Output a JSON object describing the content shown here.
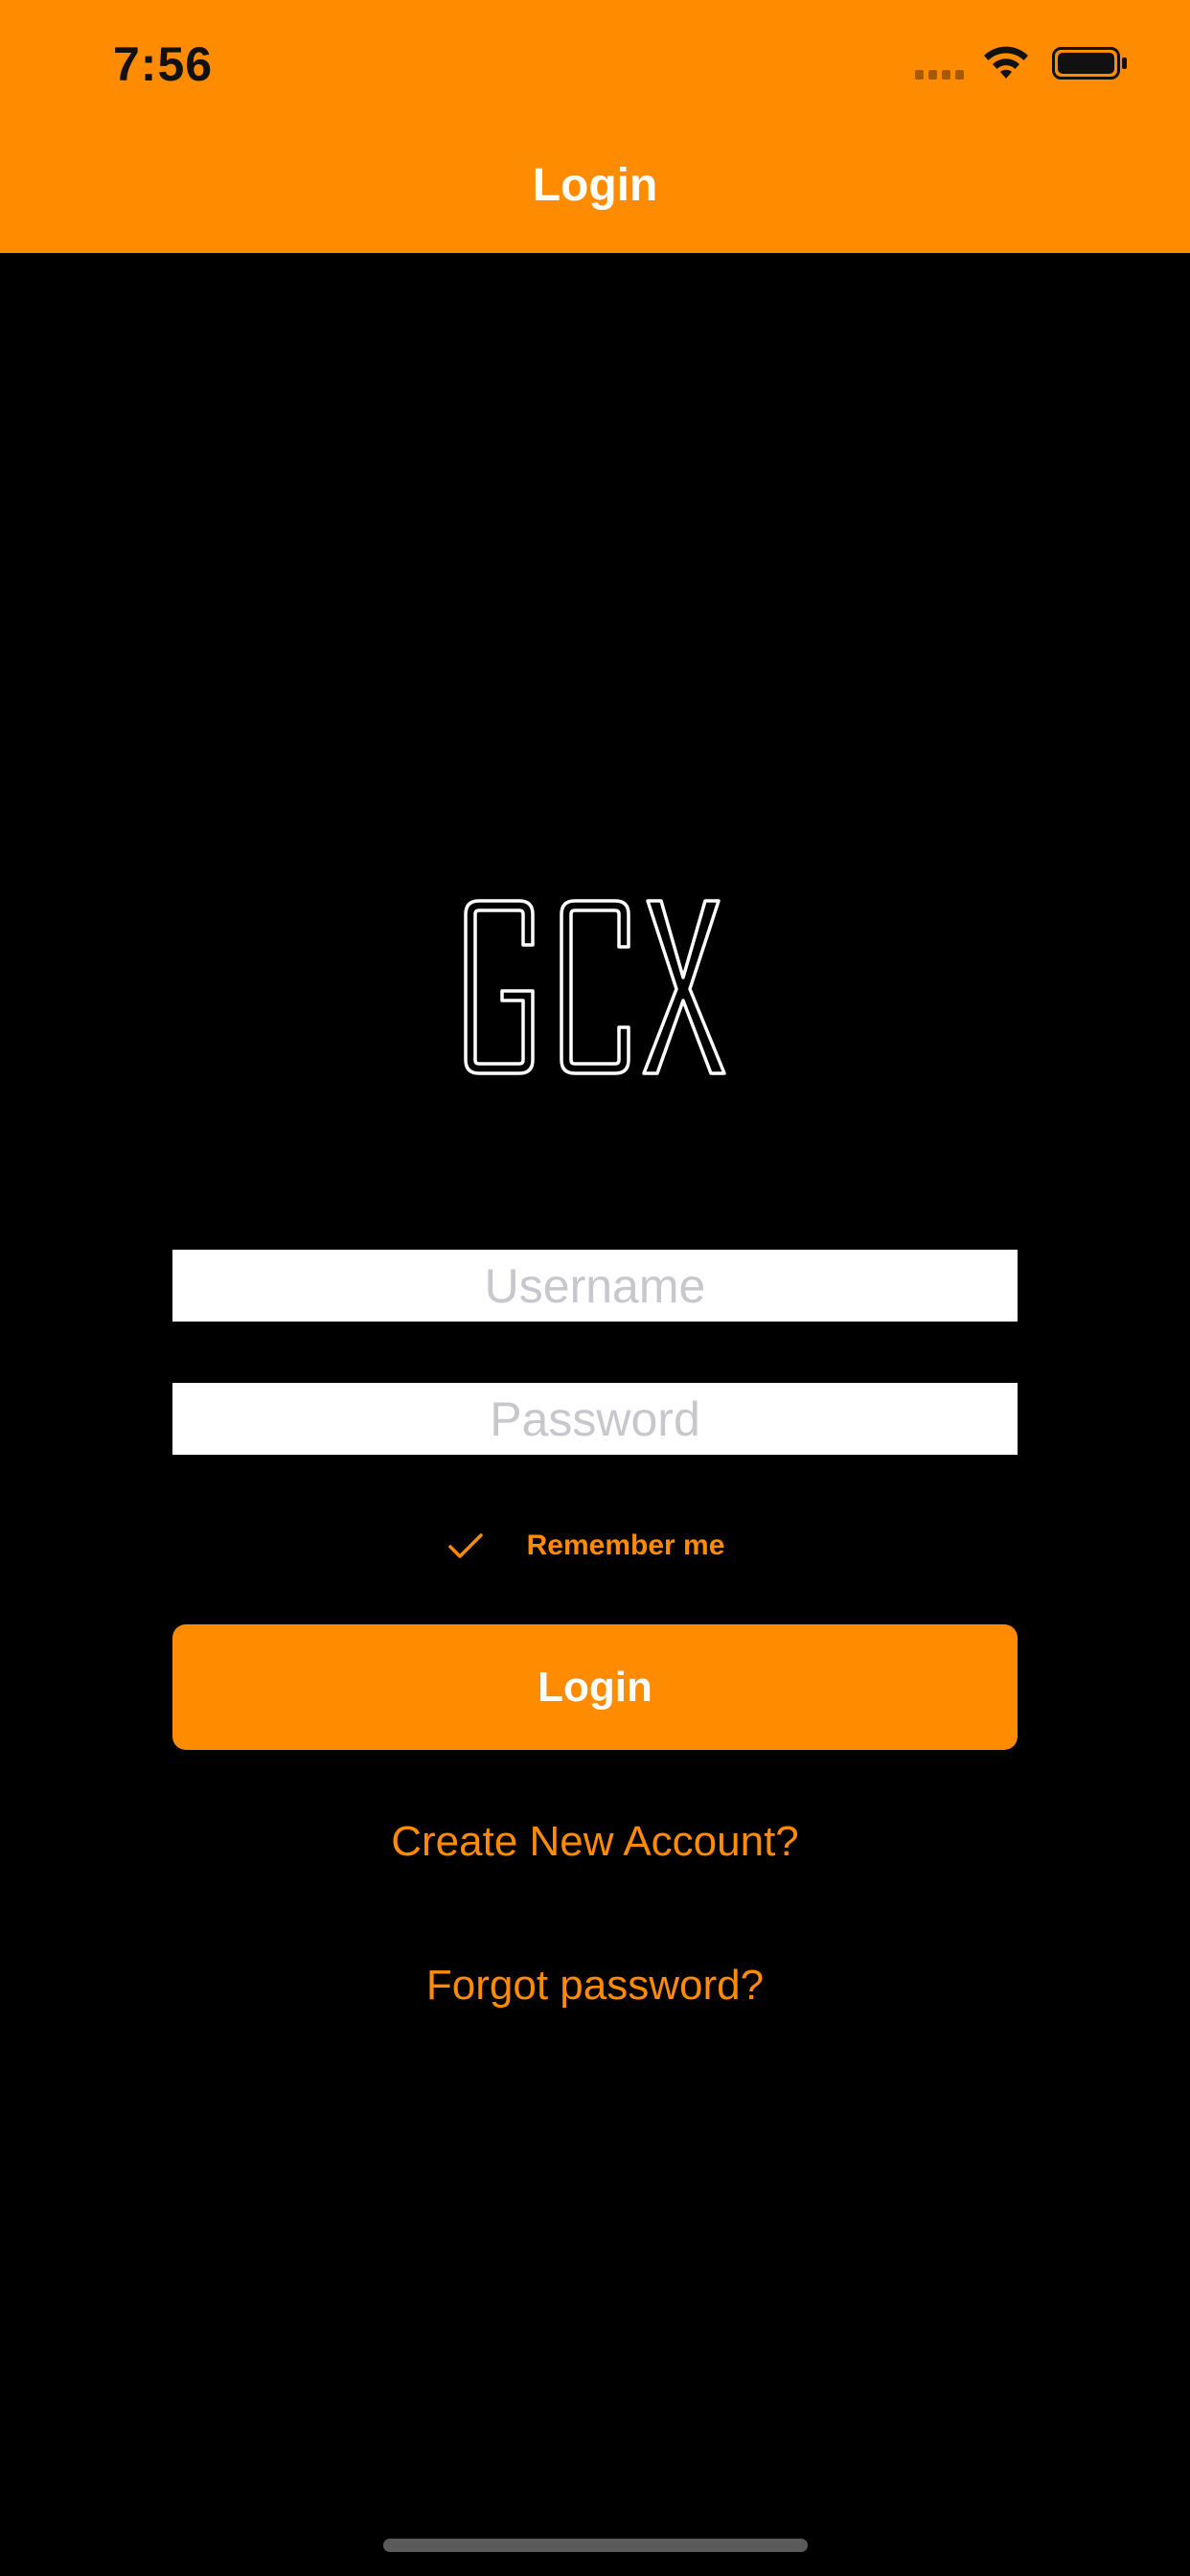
{
  "status_bar": {
    "time": "7:56",
    "icons": [
      "signal-icon",
      "wifi-icon",
      "battery-icon"
    ]
  },
  "nav": {
    "title": "Login"
  },
  "logo": {
    "text": "GCX"
  },
  "form": {
    "username_placeholder": "Username",
    "password_placeholder": "Password",
    "username_value": "",
    "password_value": "",
    "remember_label": "Remember me",
    "remember_checked": true,
    "login_label": "Login"
  },
  "links": {
    "create_account": "Create New Account?",
    "forgot_password": "Forgot password?"
  },
  "colors": {
    "accent": "#FF8C00",
    "background": "#000000",
    "field_background": "#FFFFFF",
    "placeholder": "#C7C7CD"
  }
}
